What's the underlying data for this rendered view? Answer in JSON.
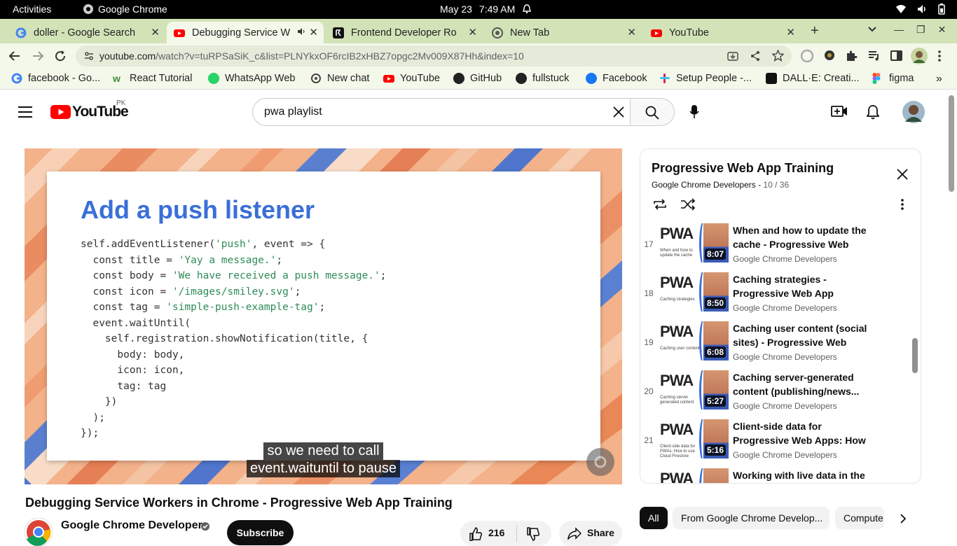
{
  "os": {
    "activities": "Activities",
    "app_name": "Google Chrome",
    "date": "May 23",
    "time": "7:49 AM"
  },
  "tabs": [
    {
      "title": "doller - Google Search",
      "icon": "google-icon"
    },
    {
      "title": "Debugging Service W",
      "icon": "youtube-icon",
      "active": true
    },
    {
      "title": "Frontend Developer Ro",
      "icon": "roadmap-icon"
    },
    {
      "title": "New Tab",
      "icon": "chrome-icon"
    },
    {
      "title": "YouTube",
      "icon": "youtube-icon"
    }
  ],
  "address_bar": {
    "host": "youtube.com",
    "path": "/watch?v=tuRPSaSiK_c&list=PLNYkxOF6rcIB2xHBZ7opgc2Mv009X87Hh&index=10"
  },
  "bookmarks": [
    {
      "label": "facebook - Go...",
      "color": "#4285f4"
    },
    {
      "label": "React Tutorial",
      "color": "#3c8d3c"
    },
    {
      "label": "WhatsApp Web",
      "color": "#25d366"
    },
    {
      "label": "New chat",
      "color": "#444444"
    },
    {
      "label": "YouTube",
      "color": "#ff0000"
    },
    {
      "label": "GitHub",
      "color": "#222222"
    },
    {
      "label": "fullstuck",
      "color": "#222222"
    },
    {
      "label": "Facebook",
      "color": "#1877f2"
    },
    {
      "label": "Setup People -...",
      "color": "#e01e5a"
    },
    {
      "label": "DALL·E: Creati...",
      "color": "#111111"
    },
    {
      "label": "figma",
      "color": "#f24e1e"
    }
  ],
  "youtube": {
    "logo_text": "YouTube",
    "region": "PK",
    "search_value": "pwa playlist"
  },
  "slide": {
    "title": "Add a push listener",
    "code_lines": [
      {
        "pre": "self.addEventListener(",
        "str": "'push'",
        "post": ", event => {"
      },
      {
        "pre": "  const title = ",
        "str": "'Yay a message.'",
        "post": ";"
      },
      {
        "pre": "  const body = ",
        "str": "'We have received a push message.'",
        "post": ";"
      },
      {
        "pre": "  const icon = ",
        "str": "'/images/smiley.svg'",
        "post": ";"
      },
      {
        "pre": "  const tag = ",
        "str": "'simple-push-example-tag'",
        "post": ";"
      },
      {
        "pre": "  event.waitUntil(",
        "str": "",
        "post": ""
      },
      {
        "pre": "    self.registration.showNotification(title, {",
        "str": "",
        "post": ""
      },
      {
        "pre": "      body: body,",
        "str": "",
        "post": ""
      },
      {
        "pre": "      icon: icon,",
        "str": "",
        "post": ""
      },
      {
        "pre": "      tag: tag",
        "str": "",
        "post": ""
      },
      {
        "pre": "    })",
        "str": "",
        "post": ""
      },
      {
        "pre": "  );",
        "str": "",
        "post": ""
      },
      {
        "pre": "});",
        "str": "",
        "post": ""
      }
    ]
  },
  "captions": [
    "so we need to call",
    "event.waituntil to pause"
  ],
  "video": {
    "title": "Debugging Service Workers in Chrome - Progressive Web App Training",
    "channel": "Google Chrome Developers",
    "subscribe_label": "Subscribe",
    "likes": "216",
    "share_label": "Share"
  },
  "playlist": {
    "title": "Progressive Web App Training",
    "channel": "Google Chrome Developers",
    "position": "10 / 36",
    "items": [
      {
        "num": "17",
        "title": "When and how to update the cache - Progressive Web App...",
        "channel": "Google Chrome Developers",
        "duration": "8:07",
        "thumb_caption": "When and how to update the cache"
      },
      {
        "num": "18",
        "title": "Caching strategies - Progressive Web App Training",
        "channel": "Google Chrome Developers",
        "duration": "8:50",
        "thumb_caption": "Caching strategies"
      },
      {
        "num": "19",
        "title": "Caching user content (social sites) - Progressive Web App...",
        "channel": "Google Chrome Developers",
        "duration": "6:08",
        "thumb_caption": "Caching user content"
      },
      {
        "num": "20",
        "title": "Caching server-generated content (publishing/news...",
        "channel": "Google Chrome Developers",
        "duration": "5:27",
        "thumb_caption": "Caching server generated content"
      },
      {
        "num": "21",
        "title": "Client-side data for Progressive Web Apps: How t...",
        "channel": "Google Chrome Developers",
        "duration": "5:16",
        "thumb_caption": "Client-side data for PWAs: How to use Cloud Firestore"
      },
      {
        "num": "",
        "title": "Working with live data in the",
        "channel": "",
        "duration": "",
        "thumb_caption": ""
      }
    ]
  },
  "chips": [
    "All",
    "From Google Chrome Develop...",
    "Compute"
  ]
}
